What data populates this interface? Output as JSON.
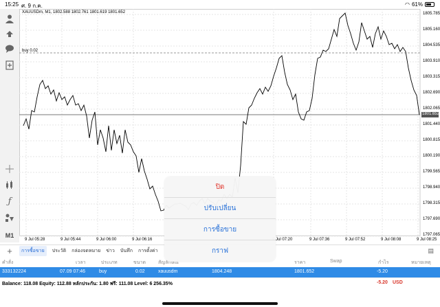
{
  "status_bar": {
    "time": "15:25",
    "date": "ศ. 9 ก.ค.",
    "battery": "61%",
    "battery_level": 0.61
  },
  "left_toolbar": {
    "icons": [
      "account-icon",
      "trade-icon",
      "chat-icon",
      "new-order-icon",
      "crosshair-icon",
      "indicators-icon",
      "function-icon",
      "objects-icon"
    ],
    "timeframe": "M1"
  },
  "chart": {
    "title": "XAUUSDm, M1, 1802.588 1802.761 1801.619 1801.652",
    "buy_line_label": "buy 0.02",
    "current_price": "1801.652",
    "y_ticks": [
      "1805.785",
      "1805.160",
      "1804.535",
      "1803.910",
      "1803.315",
      "1802.690",
      "1802.065",
      "1801.440",
      "1800.815",
      "1800.190",
      "1799.565",
      "1798.940",
      "1798.315",
      "1797.690",
      "1797.065"
    ],
    "x_ticks": [
      "9 Jul 05:28",
      "9 Jul 05:44",
      "9 Jul 06:00",
      "9 Jul 06:16",
      "9 Jul 07:20",
      "9 Jul 07:36",
      "9 Jul 07:52",
      "9 Jul 08:08",
      "9 Jul 08:25"
    ],
    "accent": "#2f8be6"
  },
  "tabs": {
    "items": [
      "การซื้อขาย",
      "ประวัติ",
      "กล่องจดหมาย",
      "ข่าว",
      "บันทึก",
      "การตั้งค่า"
    ],
    "active_index": 0
  },
  "table": {
    "headers": [
      "คำสั่ง",
      "เวลา",
      "ประเภท",
      "ขนาด",
      "สัญลักษณ์",
      "ราคา",
      "Swap",
      "กำไร",
      "หมายเหตุ"
    ],
    "row": {
      "order": "333132224",
      "time": "07.09 07:46",
      "type": "buy",
      "size": "0.02",
      "symbol": "xauusdm",
      "open_price": "1804.248",
      "current_price": "1801.652",
      "profit": "-5.20"
    }
  },
  "balance_bar": {
    "text": "Balance: 118.08 Equity: 112.88 หลักประกัน: 1.80 ฟรี: 111.08 Level: 6 256.35%",
    "profit": "-5.20",
    "currency": "USD"
  },
  "action_sheet": {
    "options": [
      "ปิด",
      "ปรับเปลี่ยน",
      "การซื้อขาย",
      "กราฟ"
    ]
  }
}
